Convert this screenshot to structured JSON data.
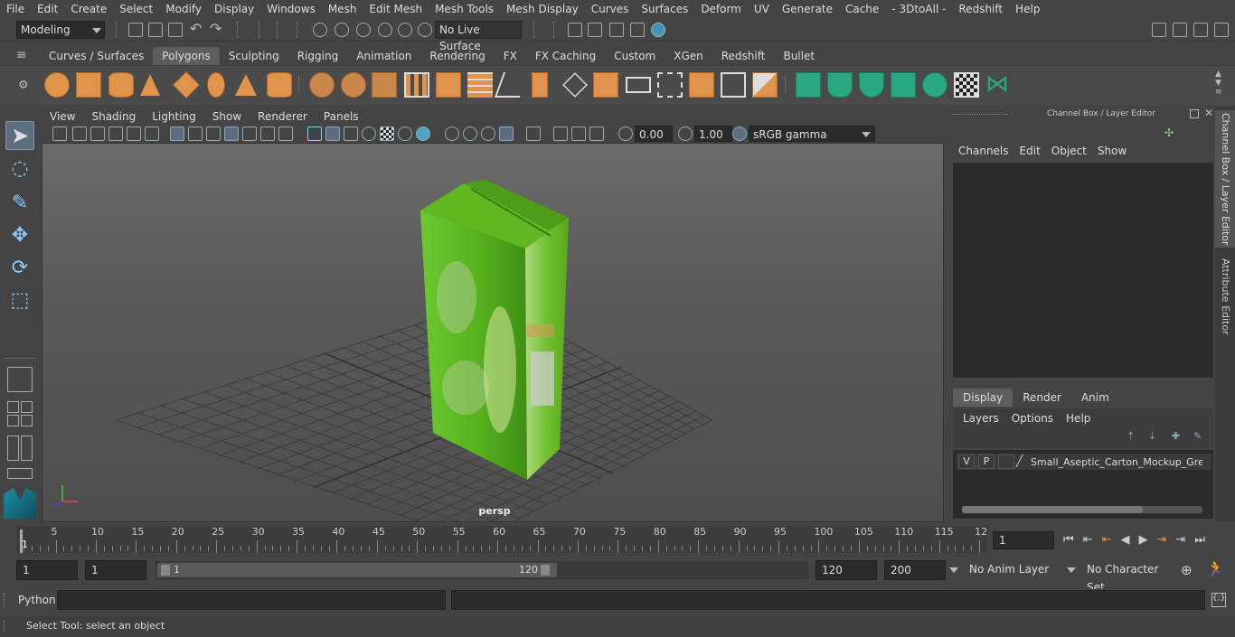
{
  "menubar": {
    "items": [
      "File",
      "Edit",
      "Create",
      "Select",
      "Modify",
      "Display",
      "Windows",
      "Mesh",
      "Edit Mesh",
      "Mesh Tools",
      "Mesh Display",
      "Curves",
      "Surfaces",
      "Deform",
      "UV",
      "Generate",
      "Cache",
      "- 3DtoAll -",
      "Redshift",
      "Help"
    ]
  },
  "statusline": {
    "mode": "Modeling",
    "live_surface": "No Live Surface"
  },
  "shelf": {
    "tabs": [
      "Curves / Surfaces",
      "Polygons",
      "Sculpting",
      "Rigging",
      "Animation",
      "Rendering",
      "FX",
      "FX Caching",
      "Custom",
      "XGen",
      "Redshift",
      "Bullet"
    ],
    "active_tab": "Polygons"
  },
  "viewport": {
    "menus": [
      "View",
      "Shading",
      "Lighting",
      "Show",
      "Renderer",
      "Panels"
    ],
    "exposure": "0.00",
    "gamma": "1.00",
    "colorspace": "sRGB gamma",
    "camera_label": "persp"
  },
  "channelbox": {
    "title": "Channel Box / Layer Editor",
    "menus": [
      "Channels",
      "Edit",
      "Object",
      "Show"
    ],
    "side_tabs": [
      "Channel Box / Layer Editor",
      "Attribute Editor"
    ]
  },
  "layer_editor": {
    "tabs": [
      "Display",
      "Render",
      "Anim"
    ],
    "active_tab": "Display",
    "menus": [
      "Layers",
      "Options",
      "Help"
    ],
    "layer": {
      "v": "V",
      "p": "P",
      "name": "Small_Aseptic_Carton_Mockup_Green"
    }
  },
  "timeline": {
    "ticks": [
      "5",
      "10",
      "15",
      "20",
      "25",
      "30",
      "35",
      "40",
      "45",
      "50",
      "55",
      "60",
      "65",
      "70",
      "75",
      "80",
      "85",
      "90",
      "95",
      "100",
      "105",
      "110",
      "115",
      "12"
    ],
    "start_marker": "1",
    "current_frame": "1"
  },
  "range": {
    "start": "1",
    "playback_start": "1",
    "slider_start": "1",
    "slider_end": "120",
    "playback_end": "120",
    "end": "200",
    "anim_layer": "No Anim Layer",
    "character_set": "No Character Set"
  },
  "cmdline": {
    "label": "Python"
  },
  "helpline": {
    "text": "Select Tool: select an object"
  },
  "colors": {
    "accent": "#5d6d7e",
    "carton_green": "#5fb820",
    "shelf_orange": "#e0934a",
    "shelf_teal": "#2aa883"
  }
}
